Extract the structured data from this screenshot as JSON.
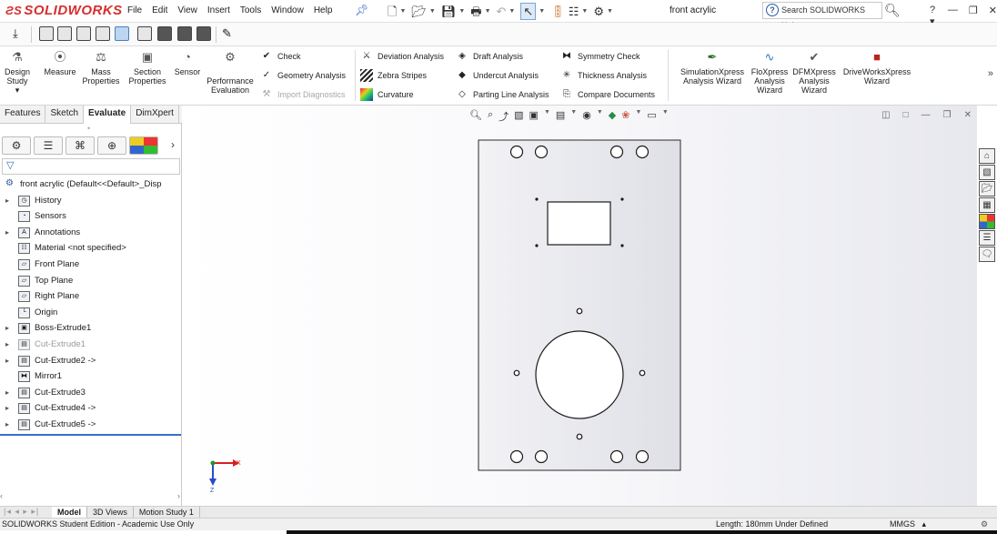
{
  "app": {
    "logo_ds": "ƧS",
    "logo_text": "SOLIDWORKS"
  },
  "menu": [
    "File",
    "Edit",
    "View",
    "Insert",
    "Tools",
    "Window",
    "Help"
  ],
  "document_title": "front acrylic",
  "help_search": {
    "placeholder": "Search SOLIDWORKS Help"
  },
  "ribbon": {
    "design_study": "Design\nStudy",
    "measure": "Measure",
    "mass_properties": "Mass\nProperties",
    "section_properties": "Section\nProperties",
    "sensor": "Sensor",
    "performance_evaluation": "Performance\nEvaluation",
    "check": "Check",
    "geometry_analysis": "Geometry Analysis",
    "import_diagnostics": "Import Diagnostics",
    "deviation_analysis": "Deviation Analysis",
    "zebra_stripes": "Zebra Stripes",
    "curvature": "Curvature",
    "draft_analysis": "Draft Analysis",
    "undercut_analysis": "Undercut Analysis",
    "parting_line_analysis": "Parting Line Analysis",
    "symmetry_check": "Symmetry Check",
    "thickness_analysis": "Thickness Analysis",
    "compare_documents": "Compare Documents",
    "simulationxpress": "SimulationXpress\nAnalysis Wizard",
    "floxpress": "FloXpress\nAnalysis\nWizard",
    "dfmxpress": "DFMXpress\nAnalysis\nWizard",
    "driveworksxpress": "DriveWorksXpress\nWizard"
  },
  "command_tabs": [
    "Features",
    "Sketch",
    "Evaluate",
    "DimXpert"
  ],
  "active_tab": "Evaluate",
  "feature_tree": {
    "root": "front acrylic  (Default<<Default>_Disp",
    "items": [
      {
        "label": "History",
        "icon": "history-icon",
        "expandable": true,
        "dim": false
      },
      {
        "label": "Sensors",
        "icon": "sensor-icon",
        "expandable": false,
        "dim": false
      },
      {
        "label": "Annotations",
        "icon": "annotation-icon",
        "expandable": true,
        "dim": false
      },
      {
        "label": "Material <not specified>",
        "icon": "material-icon",
        "expandable": false,
        "dim": false
      },
      {
        "label": "Front Plane",
        "icon": "plane-icon",
        "expandable": false,
        "dim": false
      },
      {
        "label": "Top Plane",
        "icon": "plane-icon",
        "expandable": false,
        "dim": false
      },
      {
        "label": "Right Plane",
        "icon": "plane-icon",
        "expandable": false,
        "dim": false
      },
      {
        "label": "Origin",
        "icon": "origin-icon",
        "expandable": false,
        "dim": false
      },
      {
        "label": "Boss-Extrude1",
        "icon": "extrude-icon",
        "expandable": true,
        "dim": false
      },
      {
        "label": "Cut-Extrude1",
        "icon": "cut-extrude-icon",
        "expandable": true,
        "dim": true
      },
      {
        "label": "Cut-Extrude2 ->",
        "icon": "cut-extrude-icon",
        "expandable": true,
        "dim": false
      },
      {
        "label": "Mirror1",
        "icon": "mirror-icon",
        "expandable": false,
        "dim": false
      },
      {
        "label": "Cut-Extrude3",
        "icon": "cut-extrude-icon",
        "expandable": true,
        "dim": false
      },
      {
        "label": "Cut-Extrude4 ->",
        "icon": "cut-extrude-icon",
        "expandable": true,
        "dim": false
      },
      {
        "label": "Cut-Extrude5 ->",
        "icon": "cut-extrude-icon",
        "expandable": true,
        "dim": false
      }
    ]
  },
  "bottom_tabs": [
    "Model",
    "3D Views",
    "Motion Study 1"
  ],
  "status": {
    "edition": "SOLIDWORKS Student Edition - Academic Use Only",
    "measure": "Length: 180mm   Under Defined",
    "units": "MMGS",
    "units_arrow": "▴"
  },
  "triad": {
    "x_label": "X",
    "y_label": "Y",
    "z_label": "Z"
  },
  "colors": {
    "brand": "#d62f2f",
    "selection": "#3a6fc8",
    "triad_x": "#d82020",
    "triad_y": "#1a9a2a",
    "triad_z": "#2a4ad0"
  }
}
